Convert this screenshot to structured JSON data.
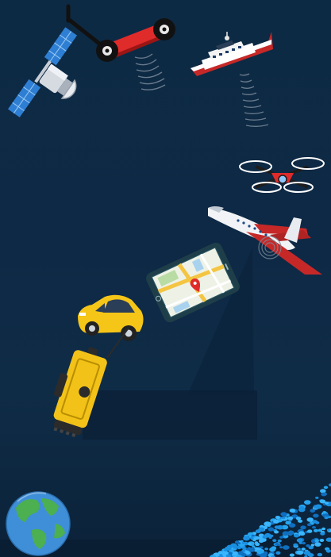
{
  "scene": {
    "background": "#0e2945",
    "accent_blue": "#1a8fe0",
    "accent_red": "#e02b2b",
    "accent_yellow": "#f2c218",
    "items": [
      "satellite-icon",
      "scooter-icon",
      "boat-icon",
      "drone-icon",
      "airplane-icon",
      "tablet-map-icon",
      "car-icon",
      "total-station-icon",
      "globe-icon",
      "data-points-icon"
    ]
  }
}
